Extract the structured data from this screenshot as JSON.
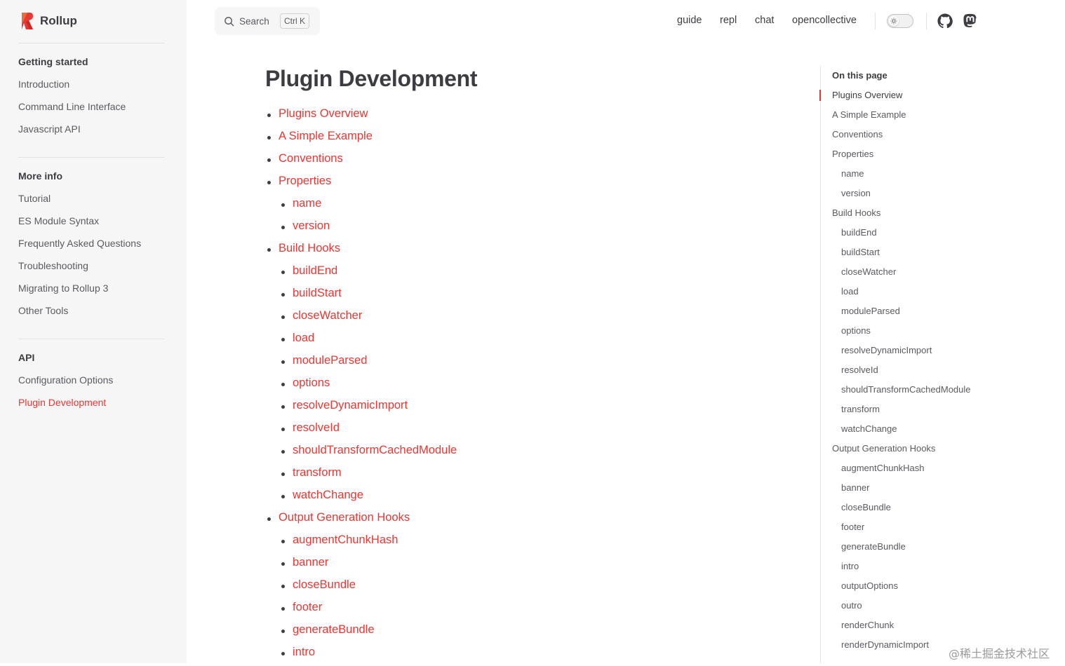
{
  "brand": {
    "name": "Rollup",
    "color": "#e53935"
  },
  "sidebar": {
    "groups": [
      {
        "title": "Getting started",
        "items": [
          "Introduction",
          "Command Line Interface",
          "Javascript API"
        ]
      },
      {
        "title": "More info",
        "items": [
          "Tutorial",
          "ES Module Syntax",
          "Frequently Asked Questions",
          "Troubleshooting",
          "Migrating to Rollup 3",
          "Other Tools"
        ]
      },
      {
        "title": "API",
        "items": [
          "Configuration Options",
          "Plugin Development"
        ]
      }
    ],
    "active_item": "Plugin Development"
  },
  "header": {
    "search": {
      "label": "Search",
      "shortcut": "Ctrl K"
    },
    "nav": [
      "guide",
      "repl",
      "chat",
      "opencollective"
    ],
    "theme_toggle": {
      "mode": "light",
      "icon": "sun-icon"
    },
    "social": [
      "github-icon",
      "mastodon-icon"
    ]
  },
  "main": {
    "title": "Plugin Development",
    "toc": [
      {
        "label": "Plugins Overview",
        "level": 1
      },
      {
        "label": "A Simple Example",
        "level": 1
      },
      {
        "label": "Conventions",
        "level": 1
      },
      {
        "label": "Properties",
        "level": 1
      },
      {
        "label": "name",
        "level": 2
      },
      {
        "label": "version",
        "level": 2
      },
      {
        "label": "Build Hooks",
        "level": 1
      },
      {
        "label": "buildEnd",
        "level": 2
      },
      {
        "label": "buildStart",
        "level": 2
      },
      {
        "label": "closeWatcher",
        "level": 2
      },
      {
        "label": "load",
        "level": 2
      },
      {
        "label": "moduleParsed",
        "level": 2
      },
      {
        "label": "options",
        "level": 2
      },
      {
        "label": "resolveDynamicImport",
        "level": 2
      },
      {
        "label": "resolveId",
        "level": 2
      },
      {
        "label": "shouldTransformCachedModule",
        "level": 2
      },
      {
        "label": "transform",
        "level": 2
      },
      {
        "label": "watchChange",
        "level": 2
      },
      {
        "label": "Output Generation Hooks",
        "level": 1
      },
      {
        "label": "augmentChunkHash",
        "level": 2
      },
      {
        "label": "banner",
        "level": 2
      },
      {
        "label": "closeBundle",
        "level": 2
      },
      {
        "label": "footer",
        "level": 2
      },
      {
        "label": "generateBundle",
        "level": 2
      },
      {
        "label": "intro",
        "level": 2
      }
    ]
  },
  "outline": {
    "title": "On this page",
    "active": "Plugins Overview",
    "items": [
      {
        "label": "Plugins Overview",
        "level": 1
      },
      {
        "label": "A Simple Example",
        "level": 1
      },
      {
        "label": "Conventions",
        "level": 1
      },
      {
        "label": "Properties",
        "level": 1
      },
      {
        "label": "name",
        "level": 2
      },
      {
        "label": "version",
        "level": 2
      },
      {
        "label": "Build Hooks",
        "level": 1
      },
      {
        "label": "buildEnd",
        "level": 2
      },
      {
        "label": "buildStart",
        "level": 2
      },
      {
        "label": "closeWatcher",
        "level": 2
      },
      {
        "label": "load",
        "level": 2
      },
      {
        "label": "moduleParsed",
        "level": 2
      },
      {
        "label": "options",
        "level": 2
      },
      {
        "label": "resolveDynamicImport",
        "level": 2
      },
      {
        "label": "resolveId",
        "level": 2
      },
      {
        "label": "shouldTransformCachedModule",
        "level": 2
      },
      {
        "label": "transform",
        "level": 2
      },
      {
        "label": "watchChange",
        "level": 2
      },
      {
        "label": "Output Generation Hooks",
        "level": 1
      },
      {
        "label": "augmentChunkHash",
        "level": 2
      },
      {
        "label": "banner",
        "level": 2
      },
      {
        "label": "closeBundle",
        "level": 2
      },
      {
        "label": "footer",
        "level": 2
      },
      {
        "label": "generateBundle",
        "level": 2
      },
      {
        "label": "intro",
        "level": 2
      },
      {
        "label": "outputOptions",
        "level": 2
      },
      {
        "label": "outro",
        "level": 2
      },
      {
        "label": "renderChunk",
        "level": 2
      },
      {
        "label": "renderDynamicImport",
        "level": 2
      }
    ]
  },
  "watermark": "@稀土掘金技术社区",
  "colors": {
    "accent": "#e53935",
    "sidebar_bg": "#f6f6f7",
    "text": "#3c3c43",
    "muted": "#5a5a61"
  }
}
